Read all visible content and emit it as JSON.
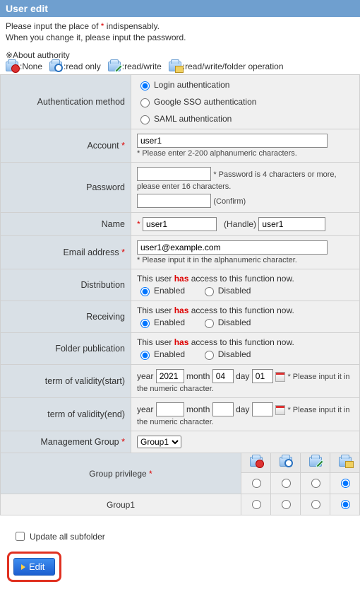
{
  "title": "User edit",
  "intro_line1_pre": "Please input the place of ",
  "intro_line1_post": " indispensably.",
  "intro_line2": "When you change it, please input the password.",
  "authority_header": "※About authority",
  "authority_levels": {
    "none": ":None",
    "ro": ":read only",
    "rw": ":read/write",
    "rwf": ":read/write/folder operation"
  },
  "labels": {
    "auth_method": "Authentication method",
    "account": "Account",
    "password": "Password",
    "name": "Name",
    "email": "Email address",
    "distribution": "Distribution",
    "receiving": "Receiving",
    "folder_pub": "Folder publication",
    "validity_start": "term of validity(start)",
    "validity_end": "term of validity(end)",
    "mgmt_group": "Management Group"
  },
  "auth_options": {
    "login": "Login authentication",
    "google": "Google SSO authentication",
    "saml": "SAML authentication"
  },
  "account": {
    "value": "user1",
    "hint": "* Please enter 2-200 alphanumeric characters."
  },
  "password": {
    "hint": "* Password is 4 characters or more, please enter 16 characters.",
    "confirm": "(Confirm)"
  },
  "name": {
    "value": "user1",
    "handle_label": "(Handle)",
    "handle_value": "user1"
  },
  "email": {
    "value": "user1@example.com",
    "hint": "* Please input it in the alphanumeric character."
  },
  "access_text_pre": "This user ",
  "access_has": "has",
  "access_text_post": " access to this function now.",
  "enabled": "Enabled",
  "disabled": "Disabled",
  "date_year": "year",
  "date_month": "month",
  "date_day": "day",
  "date_hint": "* Please input it in the numeric character.",
  "start": {
    "year": "2021",
    "month": "04",
    "day": "01"
  },
  "end": {
    "year": "",
    "month": "",
    "day": ""
  },
  "mgmt_group_value": "Group1",
  "group_priv_label": "Group privilege",
  "group_rows": [
    {
      "name": "",
      "selected": 3
    },
    {
      "name": "Group1",
      "selected": 3
    }
  ],
  "update_subfolder": "Update all subfolder",
  "edit_button": "Edit"
}
